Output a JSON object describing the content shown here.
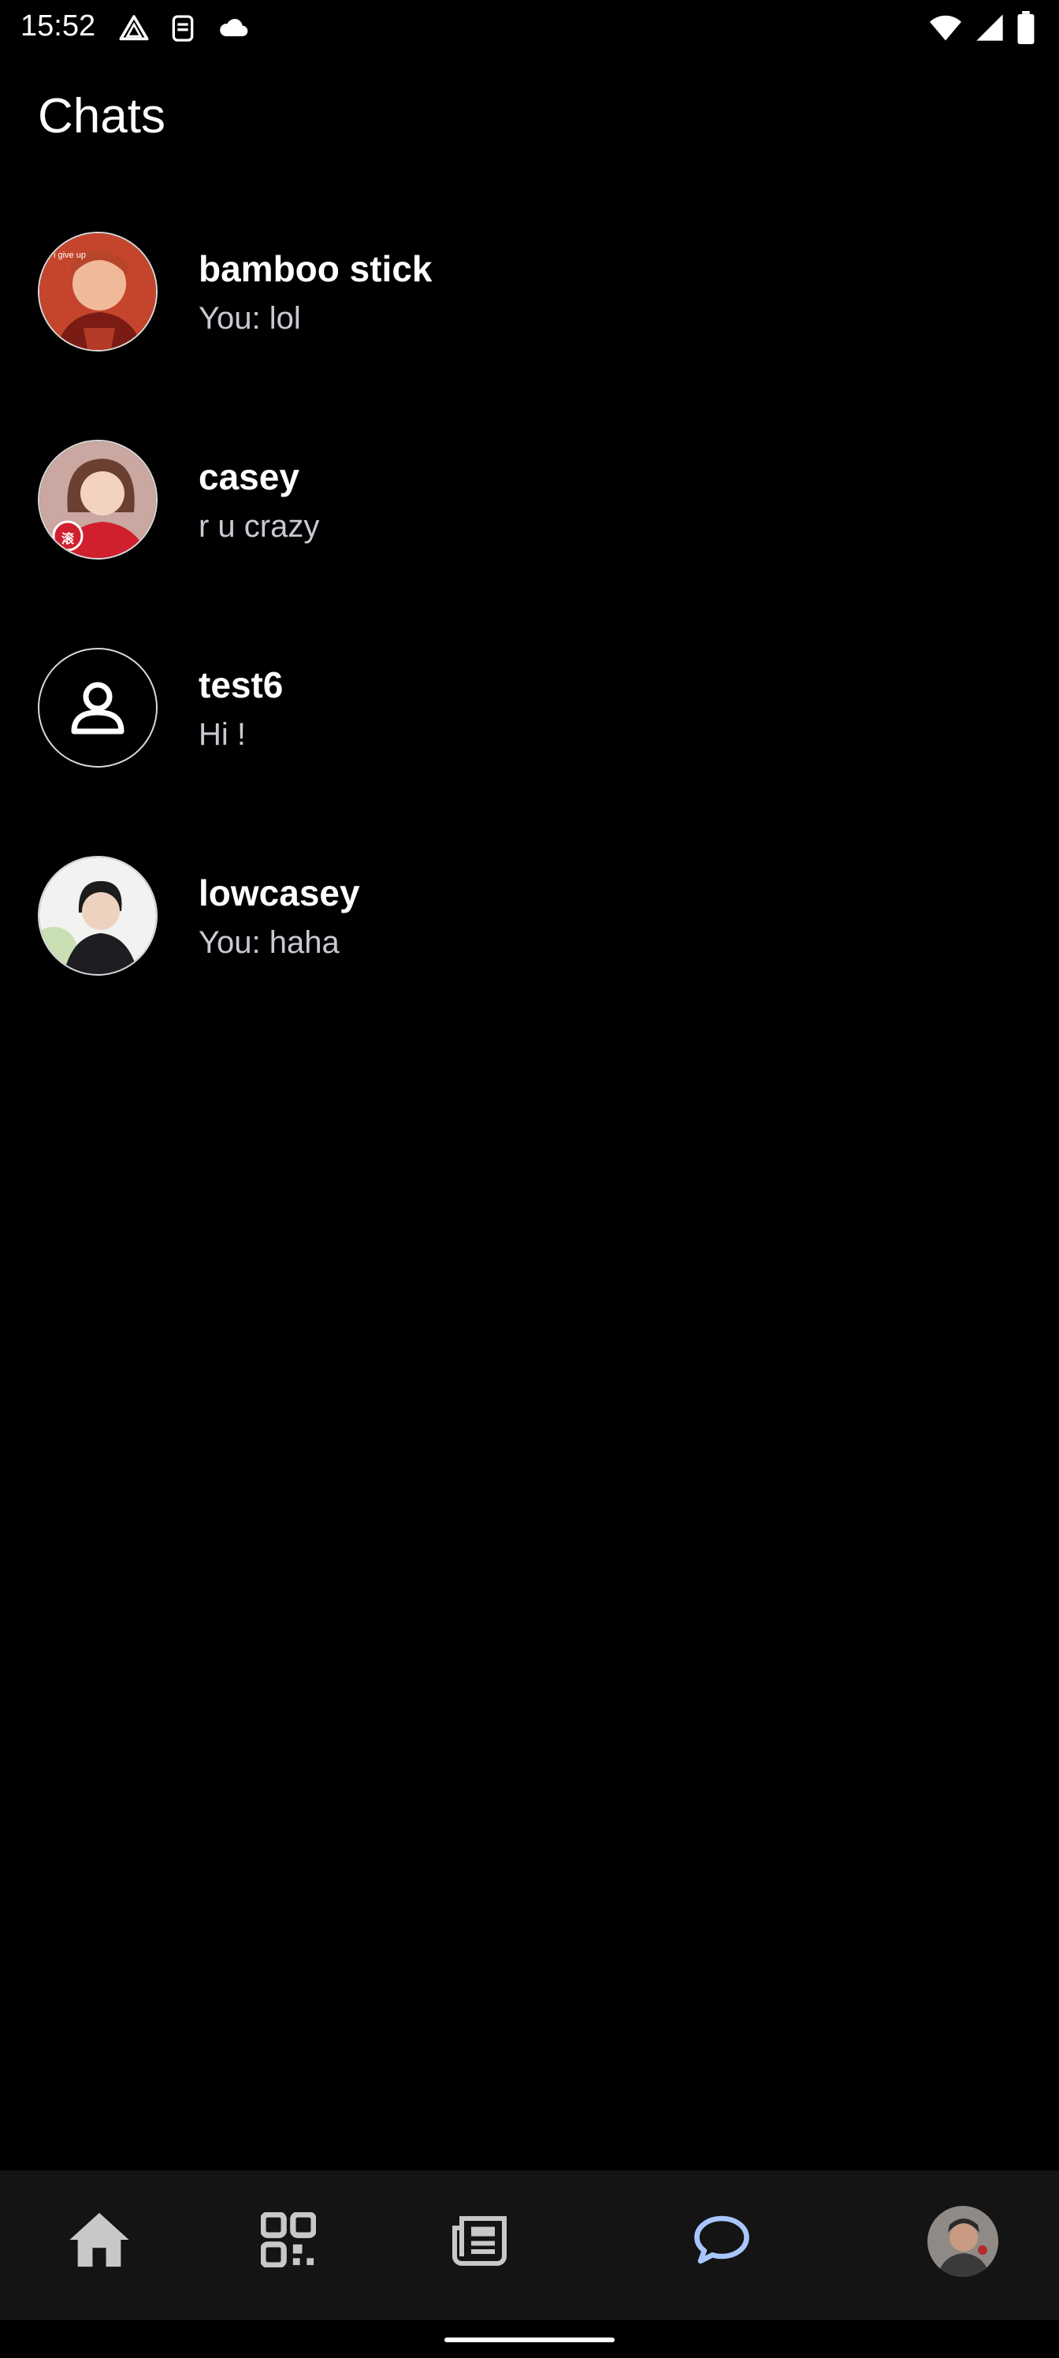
{
  "status_bar": {
    "time": "15:52",
    "left_icons": [
      "drive-icon",
      "shield-icon",
      "cloud-icon"
    ],
    "right_icons": [
      "wifi-icon",
      "signal-icon",
      "battery-icon"
    ]
  },
  "header": {
    "title": "Chats"
  },
  "chats": [
    {
      "name": "bamboo stick",
      "preview": "You: lol",
      "avatar": "photo-red",
      "avatar_text": "i give up"
    },
    {
      "name": "casey",
      "preview": "r u crazy",
      "avatar": "photo-pink",
      "avatar_text": "滚"
    },
    {
      "name": "test6",
      "preview": "Hi !",
      "avatar": "default-person-icon",
      "avatar_text": ""
    },
    {
      "name": "lowcasey",
      "preview": "You: haha",
      "avatar": "photo-light",
      "avatar_text": ""
    }
  ],
  "bottom_nav": {
    "items": [
      "home-icon",
      "qr-code-icon",
      "news-icon",
      "chat-bubble-icon",
      "profile-avatar"
    ],
    "active": "chat-bubble-icon",
    "active_color": "#a9c7ff"
  }
}
